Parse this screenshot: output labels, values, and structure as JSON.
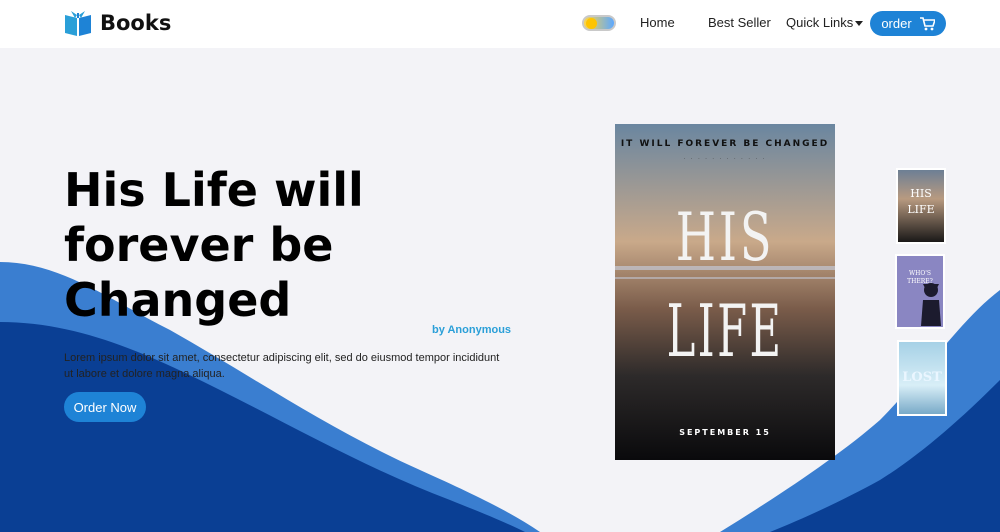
{
  "nav": {
    "brand": "Books",
    "links": [
      "Home",
      "Best Seller",
      "Quick Links"
    ],
    "order_label": "order",
    "accent": "#1e83d6"
  },
  "hero": {
    "title": "His Life will forever be Changed",
    "author": "by Anonymous",
    "description": "Lorem ipsum dolor sit amet, consectetur adipiscing elit, sed do eiusmod tempor incididunt ut labore et dolore magna aliqua.",
    "cta": "Order Now"
  },
  "cover": {
    "top_text": "IT WILL FOREVER BE CHANGED",
    "title_top": "HIS",
    "title_bottom": "LIFE",
    "date": "SEPTEMBER 15"
  },
  "thumbnails": [
    {
      "text": "HIS LIFE"
    },
    {
      "text": "WHO'S THERE?"
    },
    {
      "text": "LOST"
    }
  ],
  "colors": {
    "wave_dark": "#0a3f94",
    "wave_light": "#3a7ed0",
    "background": "#f3f3f7"
  }
}
